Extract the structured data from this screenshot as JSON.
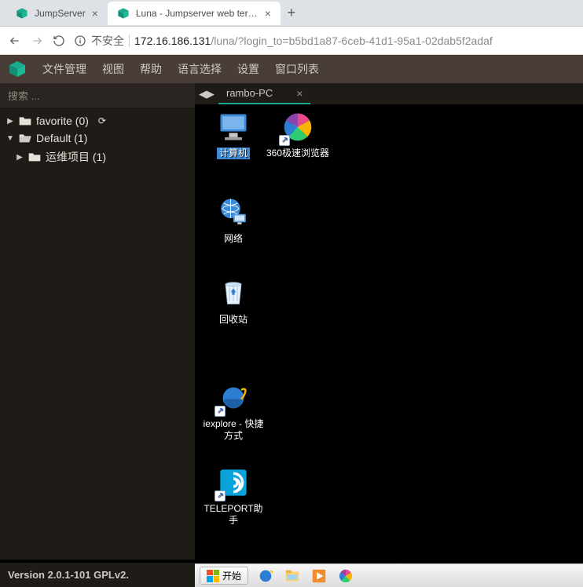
{
  "browser": {
    "tabs": [
      {
        "title": "JumpServer",
        "active": false
      },
      {
        "title": "Luna - Jumpserver web termin",
        "active": true
      }
    ],
    "insecure_label": "不安全",
    "url_host": "172.16.186.131",
    "url_path": "/luna/?login_to=b5bd1a87-6ceb-41d1-95a1-02dab5f2adaf"
  },
  "menu": {
    "file_manage": "文件管理",
    "view": "视图",
    "help": "帮助",
    "language": "语言选择",
    "settings": "设置",
    "windows": "窗口列表"
  },
  "sidebar": {
    "search_placeholder": "搜索 ...",
    "favorite_label": "favorite (0)",
    "default_label": "Default (1)",
    "project_label": "运维项目 (1)",
    "version": "Version 2.0.1-101 GPLv2."
  },
  "session": {
    "tab_label": "rambo-PC"
  },
  "desktop": {
    "computer": "计算机",
    "network": "网络",
    "recycle": "回收站",
    "iexplore": "iexplore - 快捷方式",
    "teleport": "TELEPORT助手",
    "browser360": "360极速浏览器"
  },
  "taskbar": {
    "start": "开始"
  }
}
